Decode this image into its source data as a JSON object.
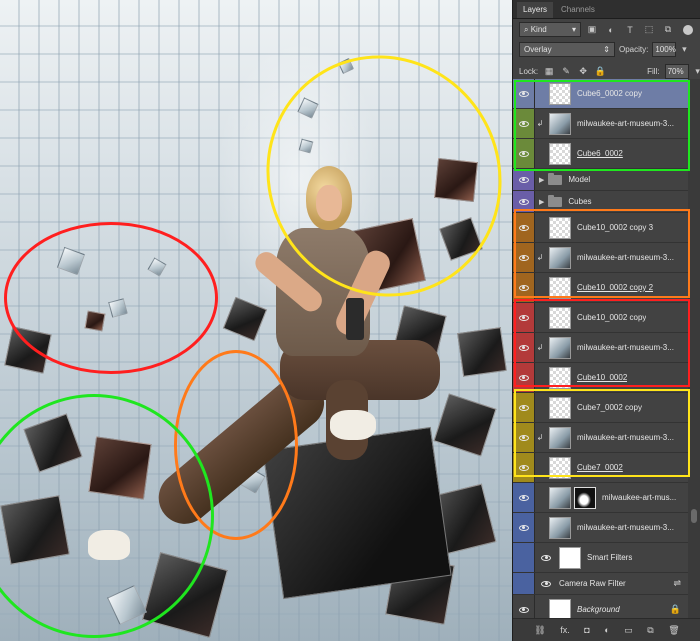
{
  "panel": {
    "tabs": [
      {
        "label": "Layers",
        "active": true
      },
      {
        "label": "Channels",
        "active": false
      }
    ],
    "filter": {
      "kind_label": "Kind",
      "icons": [
        "pixel-filter-icon",
        "adjustment-filter-icon",
        "type-filter-icon",
        "shape-filter-icon",
        "smart-object-filter-icon"
      ]
    },
    "blend_mode": "Overlay",
    "opacity_label": "Opacity:",
    "opacity_value": "100%",
    "lock_label": "Lock:",
    "fill_label": "Fill:",
    "fill_value": "70%",
    "layers": [
      {
        "name": "Cube6_0002 copy",
        "type": "pixel",
        "group_color": "#6e7da6",
        "selected": true
      },
      {
        "name": "milwaukee-art-museum-3...",
        "type": "clipped-photo",
        "group_color": "#6b8a3a"
      },
      {
        "name": "Cube6_0002",
        "type": "pixel",
        "group_color": "#6b8a3a"
      },
      {
        "name": "Model",
        "type": "group",
        "group_color": "#6a5ea8"
      },
      {
        "name": "Cubes",
        "type": "group",
        "group_color": "#6a5ea8"
      },
      {
        "name": "Cube10_0002 copy 3",
        "type": "pixel",
        "group_color": "#a0651f"
      },
      {
        "name": "milwaukee-art-museum-3...",
        "type": "clipped-photo",
        "group_color": "#a0651f"
      },
      {
        "name": "Cube10_0002 copy 2",
        "type": "pixel",
        "group_color": "#a0651f"
      },
      {
        "name": "Cube10_0002 copy",
        "type": "pixel",
        "group_color": "#b33a3a"
      },
      {
        "name": "milwaukee-art-museum-3...",
        "type": "clipped-photo",
        "group_color": "#b33a3a"
      },
      {
        "name": "Cube10_0002",
        "type": "pixel",
        "group_color": "#b33a3a"
      },
      {
        "name": "Cube7_0002 copy",
        "type": "pixel",
        "group_color": "#a08a1c"
      },
      {
        "name": "milwaukee-art-museum-3...",
        "type": "clipped-photo",
        "group_color": "#a08a1c"
      },
      {
        "name": "Cube7_0002",
        "type": "pixel",
        "group_color": "#a08a1c"
      },
      {
        "name": "milwaukee-art-mus...",
        "type": "photo-mask",
        "group_color": "#4a62a0"
      },
      {
        "name": "milwaukee-art-museum-3...",
        "type": "smart-object",
        "group_color": "#4a62a0"
      },
      {
        "name": "Smart Filters",
        "type": "smart-filters",
        "group_color": "#4a62a0"
      },
      {
        "name": "Camera Raw Filter",
        "type": "filter",
        "group_color": "#4a62a0"
      },
      {
        "name": "Background",
        "type": "background",
        "group_color": "#424242"
      }
    ],
    "bottom_icons": [
      "link-layers-icon",
      "fx-icon",
      "add-mask-icon",
      "adjustment-layer-icon",
      "new-group-icon",
      "new-layer-icon",
      "delete-layer-icon"
    ],
    "bottom_labels": {
      "link": "⛓",
      "fx": "fx.",
      "mask": "◘",
      "adj": "◐",
      "group": "▭",
      "new": "⧉",
      "trash": "🗑"
    }
  },
  "annotations": {
    "colors": {
      "green": "#1fe61f",
      "orange": "#ff7a1a",
      "red": "#ff1f1f",
      "yellow": "#ffe41a"
    }
  }
}
